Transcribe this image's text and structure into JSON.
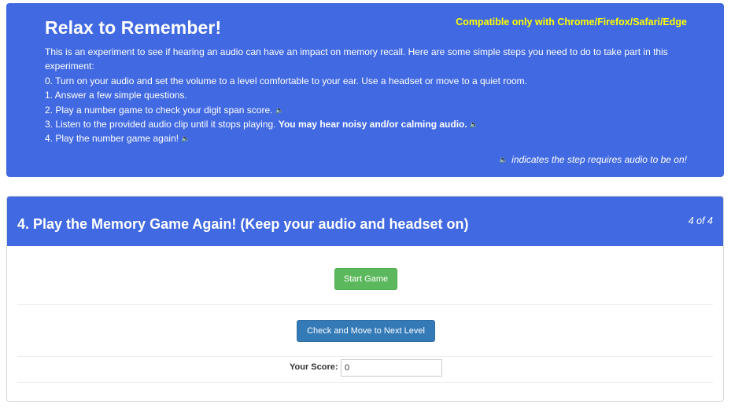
{
  "intro": {
    "title": "Relax to Remember!",
    "compatibility": "Compatible only with Chrome/Firefox/Safari/Edge",
    "description": "This is an experiment to see if hearing an audio can have an impact on memory recall. Here are some simple steps you need to do to take part in this experiment:",
    "steps": [
      {
        "text": "0. Turn on your audio and set the volume to a level comfortable to your ear. Use a headset or move to a quiet room."
      },
      {
        "text": "1. Answer a few simple questions."
      },
      {
        "text": "2. Play a number game to check your digit span score.",
        "icon": "speaker-icon"
      },
      {
        "text": "3. Listen to the provided audio clip until it stops playing.",
        "emphasis": "You may hear noisy and/or calming audio.",
        "icon": "speaker-icon"
      },
      {
        "text": "4. Play the number game again!",
        "icon": "speaker-icon"
      }
    ],
    "audio_legend": "indicates the step requires audio to be on!"
  },
  "panel": {
    "title": "4. Play the Memory Game Again! (Keep your audio and headset on)",
    "step_count": "4 of 4",
    "start_button": "Start Game",
    "next_button": "Check and Move to Next Level",
    "score_label": "Your Score:",
    "score_value": "0"
  },
  "colors": {
    "header_bg": "#4169e1",
    "compat_text": "#ffff00",
    "start_button": "#5cb85c",
    "next_button": "#337ab7"
  }
}
